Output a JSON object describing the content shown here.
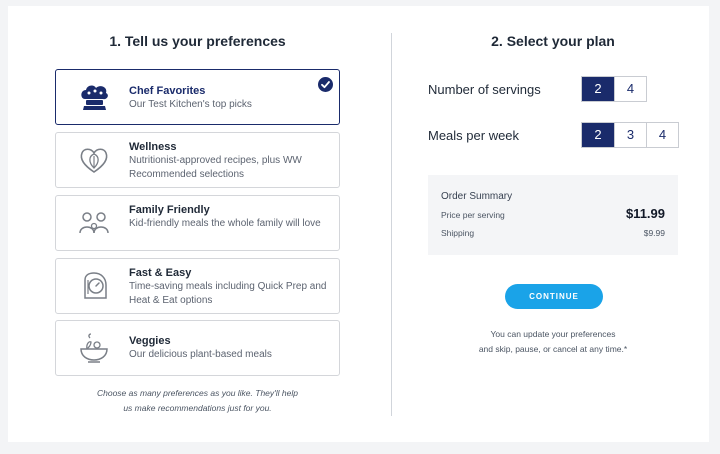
{
  "left": {
    "title": "1. Tell us your preferences",
    "preferences": [
      {
        "title": "Chef Favorites",
        "desc": "Our Test Kitchen's top picks",
        "icon": "chef-hat-icon",
        "selected": true
      },
      {
        "title": "Wellness",
        "desc": "Nutritionist-approved recipes, plus WW Recommended selections",
        "icon": "heart-leaf-icon",
        "selected": false
      },
      {
        "title": "Family Friendly",
        "desc": "Kid-friendly meals the whole family will love",
        "icon": "family-icon",
        "selected": false
      },
      {
        "title": "Fast & Easy",
        "desc": "Time-saving meals including Quick Prep and Heat & Eat options",
        "icon": "timer-icon",
        "selected": false
      },
      {
        "title": "Veggies",
        "desc": "Our delicious plant-based meals",
        "icon": "salad-bowl-icon",
        "selected": false
      }
    ],
    "note_line1": "Choose as many preferences as you like. They'll help",
    "note_line2": "us make recommendations just for you."
  },
  "right": {
    "title": "2. Select your plan",
    "servings": {
      "label": "Number of servings",
      "options": [
        "2",
        "4"
      ],
      "selected": "2"
    },
    "meals": {
      "label": "Meals per week",
      "options": [
        "2",
        "3",
        "4"
      ],
      "selected": "2"
    },
    "summary": {
      "title": "Order Summary",
      "price_label": "Price per serving",
      "price_value": "$11.99",
      "shipping_label": "Shipping",
      "shipping_value": "$9.99"
    },
    "continue_label": "CONTINUE",
    "note_line1": "You can update your preferences",
    "note_line2": "and skip, pause, or cancel at any time.*"
  },
  "colors": {
    "accent": "#1a2b6b",
    "button": "#1aa3e8",
    "border": "#d4d6da"
  }
}
